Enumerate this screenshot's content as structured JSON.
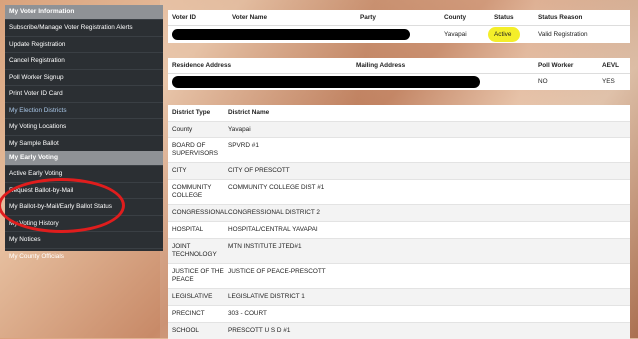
{
  "sidebar": {
    "sections": [
      {
        "header": "My Voter Information",
        "items": [
          {
            "label": "Subscribe/Manage Voter Registration Alerts"
          },
          {
            "label": "Update Registration"
          },
          {
            "label": "Cancel Registration"
          },
          {
            "label": "Poll Worker Signup"
          },
          {
            "label": "Print Voter ID Card"
          },
          {
            "label": "My Election Districts",
            "active": true
          },
          {
            "label": "My Voting Locations"
          },
          {
            "label": "My Sample Ballot"
          }
        ]
      },
      {
        "header": "My Early Voting",
        "items": [
          {
            "label": "Active Early Voting"
          },
          {
            "label": "Request Ballot-by-Mail"
          },
          {
            "label": "My Ballot-by-Mail/Early Ballot Status"
          },
          {
            "label": "My Voting History"
          },
          {
            "label": "My Notices"
          },
          {
            "label": "My County Officials"
          }
        ]
      }
    ]
  },
  "voter": {
    "headers": {
      "voter_id": "Voter ID",
      "voter_name": "Voter Name",
      "party": "Party",
      "county": "County",
      "status": "Status",
      "status_reason": "Status Reason"
    },
    "values": {
      "county": "Yavapai",
      "status": "Active",
      "status_reason": "Valid Registration"
    }
  },
  "address": {
    "headers": {
      "residence": "Residence Address",
      "mailing": "Mailing Address",
      "poll_worker": "Poll Worker",
      "aevl": "AEVL"
    },
    "values": {
      "poll_worker": "NO",
      "aevl": "YES"
    }
  },
  "districts": {
    "headers": {
      "type": "District Type",
      "name": "District Name"
    },
    "rows": [
      {
        "type": "County",
        "name": "Yavapai"
      },
      {
        "type": "BOARD OF SUPERVISORS",
        "name": "SPVRD #1"
      },
      {
        "type": "CITY",
        "name": "CITY OF PRESCOTT"
      },
      {
        "type": "COMMUNITY COLLEGE",
        "name": "COMMUNITY COLLEGE DIST #1"
      },
      {
        "type": "CONGRESSIONAL",
        "name": "CONGRESSIONAL DISTRICT 2"
      },
      {
        "type": "HOSPITAL",
        "name": "HOSPITAL/CENTRAL YAVAPAI"
      },
      {
        "type": "JOINT TECHNOLOGY",
        "name": "MTN INSTITUTE JTED#1"
      },
      {
        "type": "JUSTICE OF THE PEACE",
        "name": "JUSTICE OF PEACE-PRESCOTT"
      },
      {
        "type": "LEGISLATIVE",
        "name": "LEGISLATIVE DISTRICT 1"
      },
      {
        "type": "PRECINCT",
        "name": "303 - COURT"
      },
      {
        "type": "SCHOOL",
        "name": "PRESCOTT U S D #1"
      }
    ]
  },
  "colors": {
    "highlight": "#f4ee2a",
    "annotation": "#e01d1d",
    "sidebar_bg": "#2b2f33",
    "sidebar_header": "#8f9296"
  }
}
